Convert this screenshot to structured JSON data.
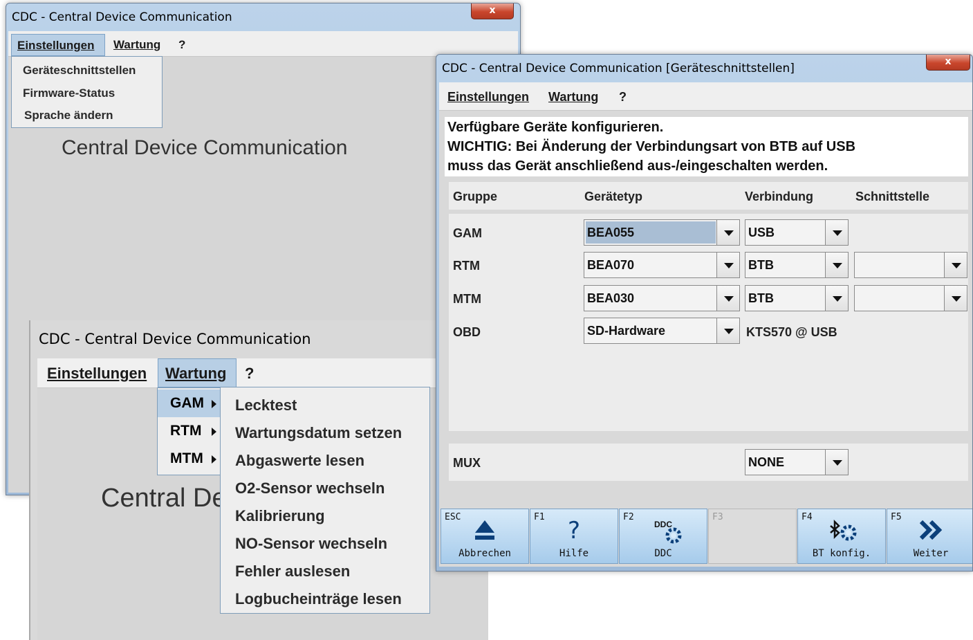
{
  "window_back": {
    "title": "CDC - Central Device Communication",
    "close_glyph": "x",
    "menu": {
      "einstellungen": "Einstellungen",
      "wartung": "Wartung",
      "help": "?"
    },
    "einstellungen_items": [
      "Geräteschnittstellen",
      "Firmware-Status",
      "Sprache ändern"
    ],
    "heading": "Central Device Communication"
  },
  "window_maint": {
    "title": "CDC - Central Device Communication",
    "menu": {
      "einstellungen": "Einstellungen",
      "wartung": "Wartung",
      "help": "?"
    },
    "wartung_items": [
      "GAM",
      "RTM",
      "MTM"
    ],
    "gam_submenu": [
      "Lecktest",
      "Wartungsdatum setzen",
      "Abgaswerte lesen",
      "O2-Sensor wechseln",
      "Kalibrierung",
      "NO-Sensor wechseln",
      "Fehler auslesen",
      "Logbucheinträge lesen"
    ],
    "heading": "Central De"
  },
  "window_config": {
    "title": "CDC - Central Device Communication [Geräteschnittstellen]",
    "close_glyph": "x",
    "menu": {
      "einstellungen": "Einstellungen",
      "wartung": "Wartung",
      "help": "?"
    },
    "header_lines": [
      "Verfügbare Geräte konfigurieren.",
      "WICHTIG: Bei Änderung der Verbindungsart von BTB auf USB",
      "muss das Gerät anschließend aus-/eingeschalten werden."
    ],
    "columns": {
      "gruppe": "Gruppe",
      "geraetetyp": "Gerätetyp",
      "verbindung": "Verbindung",
      "schnittstelle": "Schnittstelle"
    },
    "rows": [
      {
        "group": "GAM",
        "device": "BEA055",
        "connection": "USB",
        "interface": null
      },
      {
        "group": "RTM",
        "device": "BEA070",
        "connection": "BTB",
        "interface": ""
      },
      {
        "group": "MTM",
        "device": "BEA030",
        "connection": "BTB",
        "interface": ""
      },
      {
        "group": "OBD",
        "device": "SD-Hardware",
        "connection_text": "KTS570 @ USB"
      }
    ],
    "mux": {
      "label": "MUX",
      "value": "NONE"
    },
    "fkeys": [
      {
        "key": "ESC",
        "label": "Abbrechen",
        "icon": "eject-icon"
      },
      {
        "key": "F1",
        "label": "Hilfe",
        "icon": "help-icon"
      },
      {
        "key": "F2",
        "label": "DDC",
        "icon": "ddc-gear-icon"
      },
      {
        "key": "F3",
        "label": "",
        "icon": ""
      },
      {
        "key": "F4",
        "label": "BT konfig.",
        "icon": "bluetooth-gear-icon"
      },
      {
        "key": "F5",
        "label": "Weiter",
        "icon": "forward-icon"
      }
    ],
    "ddc_icon_text": "DDC"
  }
}
